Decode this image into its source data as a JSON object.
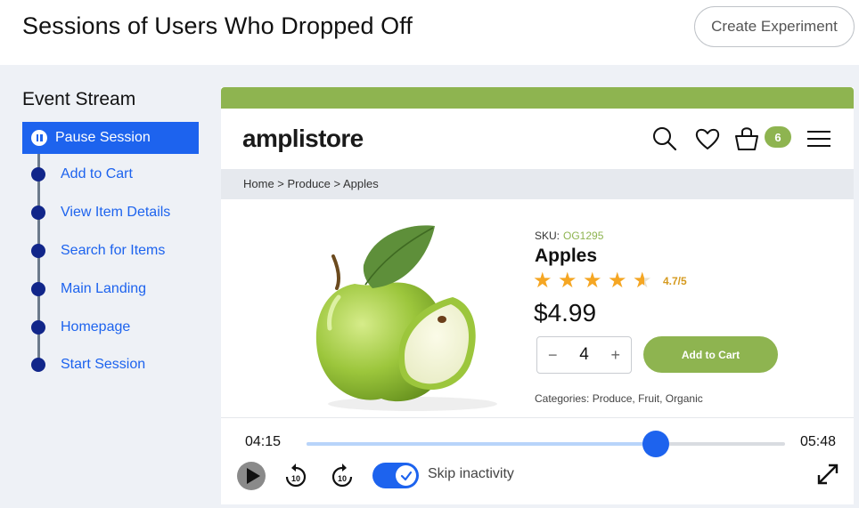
{
  "header": {
    "title": "Sessions of Users Who Dropped Off",
    "create_button": "Create Experiment"
  },
  "event_stream": {
    "title": "Event Stream",
    "active": "Pause Session",
    "items": [
      {
        "label": "Add to Cart"
      },
      {
        "label": "View Item Details"
      },
      {
        "label": "Search for Items"
      },
      {
        "label": "Main Landing"
      },
      {
        "label": "Homepage"
      },
      {
        "label": "Start Session"
      }
    ]
  },
  "store": {
    "logo": "amplistore",
    "cart_count": "6",
    "icons": [
      "search-icon",
      "heart-icon",
      "shopping-bag-icon",
      "hamburger-menu-icon"
    ],
    "breadcrumb": "Home > Produce > Apples",
    "product": {
      "sku_label": "SKU:",
      "sku": "OG1295",
      "name": "Apples",
      "rating": "4.7/5",
      "price": "$4.99",
      "quantity": "4",
      "add_to_cart": "Add to Cart",
      "categories": "Categories: Produce, Fruit, Organic"
    }
  },
  "player": {
    "current_time": "04:15",
    "total_time": "05:48",
    "progress": 0.73,
    "skip_inactivity_label": "Skip inactivity",
    "skip_inactivity_on": true,
    "rewind_label": "10",
    "forward_label": "10"
  },
  "colors": {
    "accent": "#1d63ee",
    "brand_green": "#8eb450",
    "star": "#f5a623"
  }
}
